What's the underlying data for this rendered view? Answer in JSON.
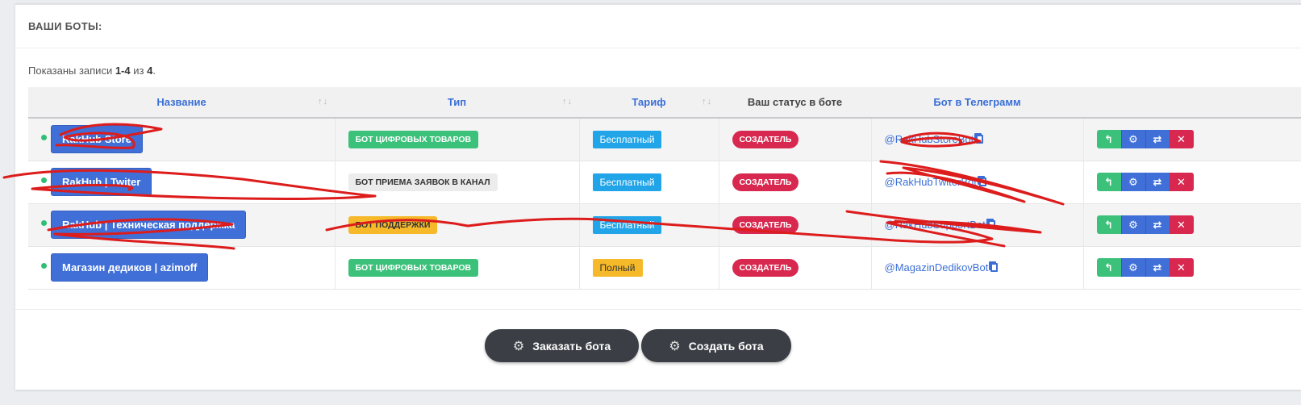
{
  "section_title": "ВАШИ БОТЫ:",
  "summary": {
    "prefix": "Показаны записи ",
    "range": "1-4",
    "middle": " из ",
    "total": "4",
    "suffix": "."
  },
  "table": {
    "headers": [
      "Название",
      "Тип",
      "Тариф",
      "Ваш статус в боте",
      "Бот в Телеграмм"
    ],
    "sort_glyph": "↑↓",
    "rows": [
      {
        "name": "RakHub Store",
        "type": "БОТ ЦИФРОВЫХ ТОВАРОВ",
        "type_style": "green",
        "tariff": "Бесплатный",
        "tariff_style": "blue",
        "status": "СОЗДАТЕЛЬ",
        "telegram": "@RakHubStoreBot"
      },
      {
        "name": "RakHub | Twiter",
        "type": "БОТ ПРИЕМА ЗАЯВОК В КАНАЛ",
        "type_style": "gray",
        "tariff": "Бесплатный",
        "tariff_style": "blue",
        "status": "СОЗДАТЕЛЬ",
        "telegram": "@RakHubTwiterBot"
      },
      {
        "name": "RakHub | Техническая поддержка",
        "type": "БОТ ПОДДЕРЖКИ",
        "type_style": "yellow",
        "tariff": "Бесплатный",
        "tariff_style": "blue",
        "status": "СОЗДАТЕЛЬ",
        "telegram": "@RakHubSupportBot"
      },
      {
        "name": "Магазин дедиков | azimoff",
        "type": "БОТ ЦИФРОВЫХ ТОВАРОВ",
        "type_style": "green",
        "tariff": "Полный",
        "tariff_style": "yellow",
        "status": "СОЗДАТЕЛЬ",
        "telegram": "@MagazinDedikovBot"
      }
    ],
    "row_actions": [
      {
        "icon": "reply-icon",
        "glyph": "↰",
        "color": "#3cc17a"
      },
      {
        "icon": "gear-icon",
        "glyph": "⚙",
        "color": "#3f6fd7"
      },
      {
        "icon": "retweet-icon",
        "glyph": "⇄",
        "color": "#3f6fd7"
      },
      {
        "icon": "close-icon",
        "glyph": "✕",
        "color": "#d8284f"
      }
    ]
  },
  "buttons": {
    "order": "Заказать бота",
    "create": "Создать бота"
  },
  "colors": {
    "primary": "#3f6fd7",
    "success": "#3cc17a",
    "danger": "#d8284f",
    "info": "#22a5e8",
    "warning": "#f5b92a",
    "dark": "#3b3f45",
    "scribble": "#dd1c1c"
  }
}
